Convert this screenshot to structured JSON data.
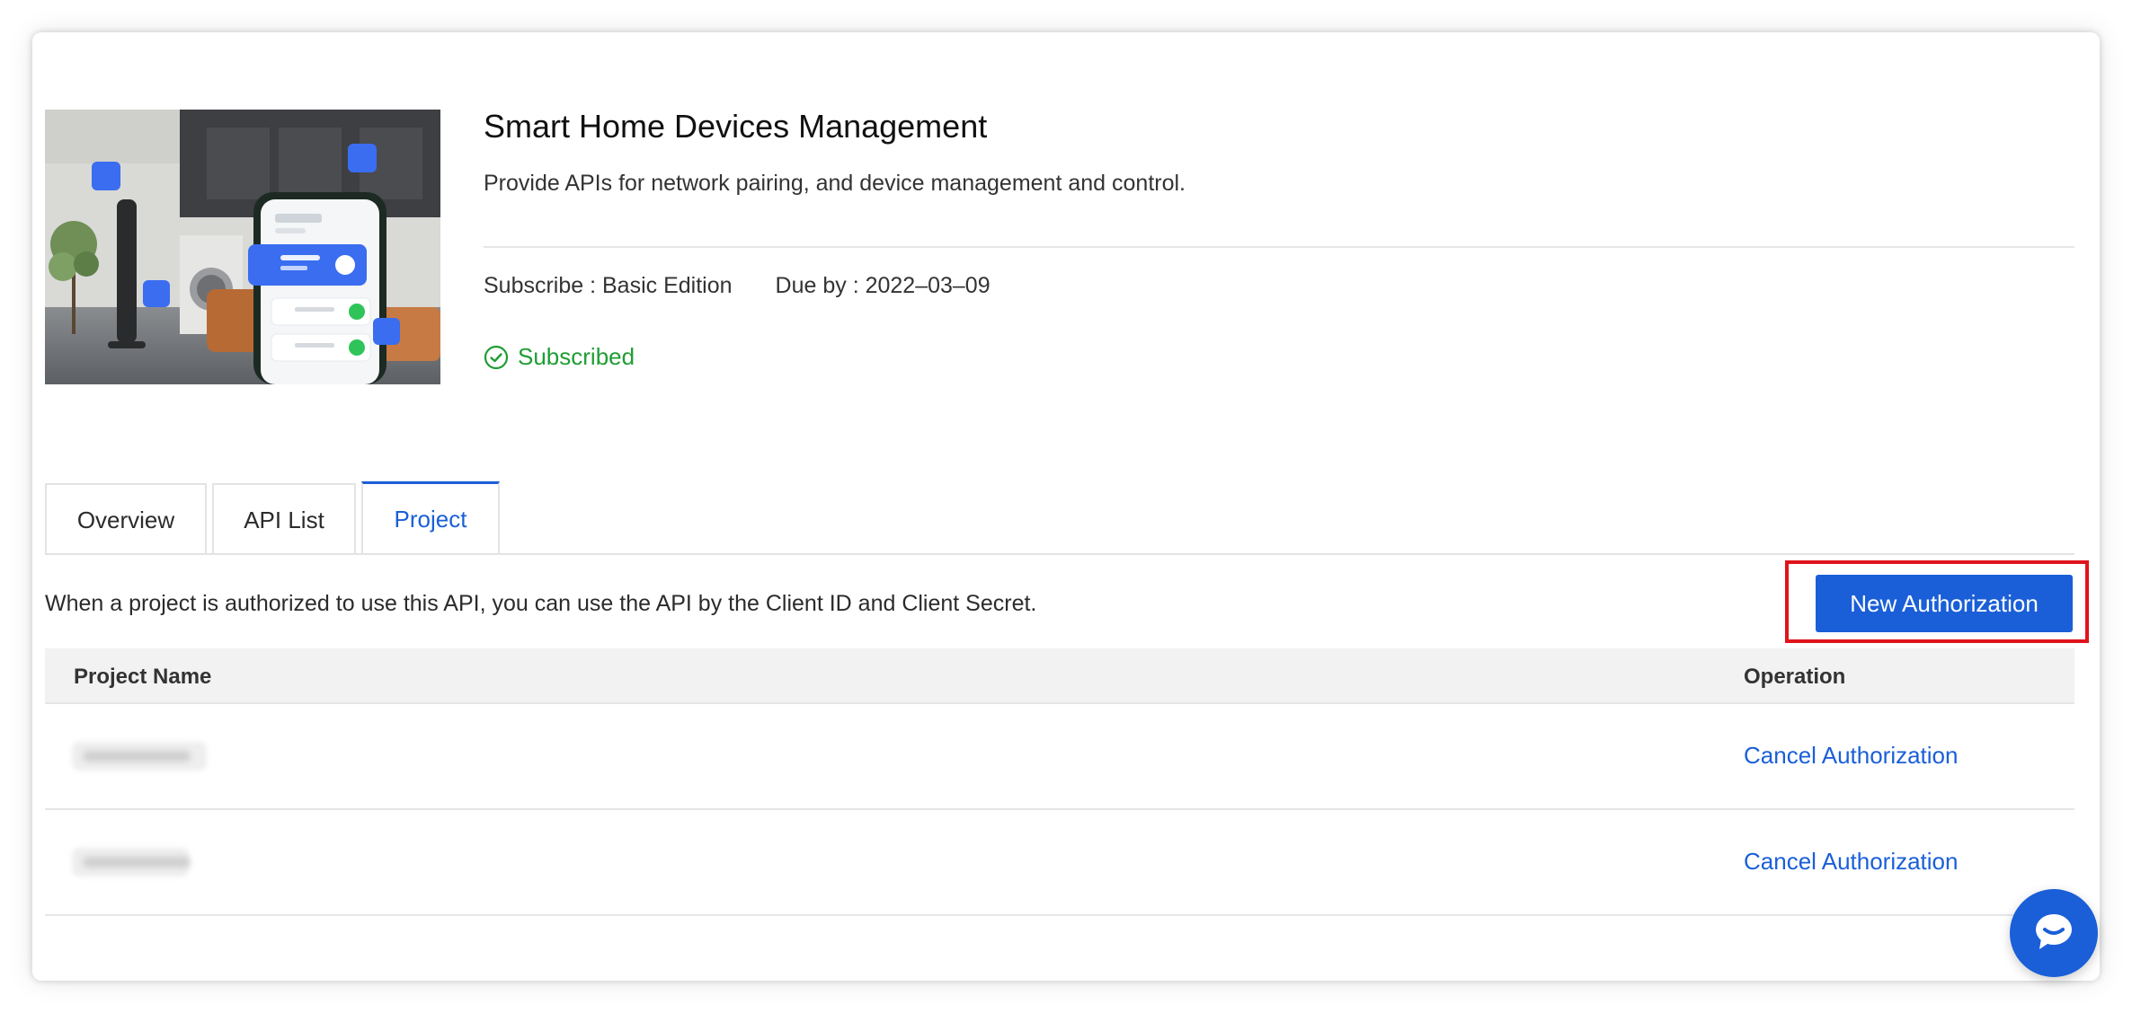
{
  "product": {
    "title": "Smart Home Devices Management",
    "description": "Provide APIs for network pairing, and device management and control.",
    "subscribe": "Subscribe : Basic Edition",
    "due": "Due by : 2022–03–09",
    "status": "Subscribed",
    "status_color": "#1f9d33"
  },
  "tabs": [
    {
      "label": "Overview",
      "active": false
    },
    {
      "label": "API List",
      "active": false
    },
    {
      "label": "Project",
      "active": true
    }
  ],
  "project": {
    "info": "When a project is authorized to use this API, you can use the API by the Client ID and Client Secret.",
    "new_auth_label": "New Authorization"
  },
  "table": {
    "headers": {
      "name": "Project Name",
      "operation": "Operation"
    },
    "rows": [
      {
        "action": "Cancel Authorization"
      },
      {
        "action": "Cancel Authorization"
      }
    ]
  },
  "colors": {
    "accent": "#1a5fd8",
    "highlight": "#e0131c"
  },
  "icons": {
    "status": "check-circle-icon",
    "chat": "chat-bubble-icon"
  }
}
